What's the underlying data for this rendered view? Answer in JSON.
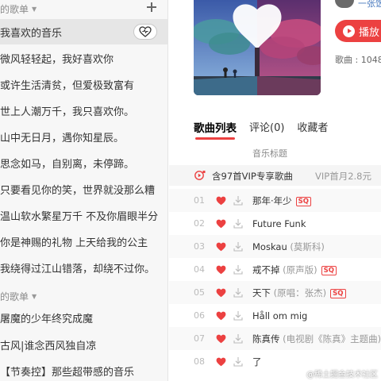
{
  "sidebar": {
    "created_header": "的歌单",
    "collected_header": "的歌单",
    "created": [
      "我喜欢的音乐",
      "微风轻轻起，我好喜欢你",
      "或许生活清贫，但爱极致富有",
      "世上人潮万千，我只喜欢你。",
      "山中无日月，遇你知星辰。",
      "思念如马，自别离，未停蹄。",
      "只要看见你的笑，世界就没那么糟",
      "温山软水繁星万千 不及你眉眼半分",
      "你是神赐的礼物 上天给我的公主",
      "我绕得过江山错落，却绕不过你。"
    ],
    "collected": [
      "屠魔的少年终究成魔",
      "古风|谁念西风独自凉",
      "【节奏控】那些超带感的音乐"
    ]
  },
  "header": {
    "creator_name": "一张饭",
    "play_label": "播放",
    "song_count": "歌曲 : 1048"
  },
  "tabs": [
    "歌曲列表",
    "评论(0)",
    "收藏者"
  ],
  "list": {
    "column_title": "音乐标题",
    "vip_text": "含97首VIP专享歌曲",
    "vip_price": "VIP首月2.8元",
    "quality_badge": "SQ",
    "tracks": [
      {
        "num": "01",
        "title": "那年·年少",
        "sub": "",
        "sq": true
      },
      {
        "num": "02",
        "title": "Future Funk",
        "sub": "",
        "sq": false
      },
      {
        "num": "03",
        "title": "Moskau",
        "sub": "(莫斯科)",
        "sq": false
      },
      {
        "num": "04",
        "title": "戒不掉",
        "sub": "(原声版)",
        "sq": true
      },
      {
        "num": "05",
        "title": "天下",
        "sub": "(原唱：张杰)",
        "sq": true
      },
      {
        "num": "06",
        "title": "Håll om mig",
        "sub": "",
        "sq": false
      },
      {
        "num": "07",
        "title": "陈真传",
        "sub": "(电视剧《陈真》主题曲)",
        "sq": false
      },
      {
        "num": "08",
        "title": "了",
        "sub": "",
        "sq": false
      }
    ]
  },
  "watermark": "@稀土掘金技术社区",
  "colors": {
    "accent": "#ec4141",
    "sidebar_bg": "#f7f7f7",
    "heart": "#ec4141"
  }
}
